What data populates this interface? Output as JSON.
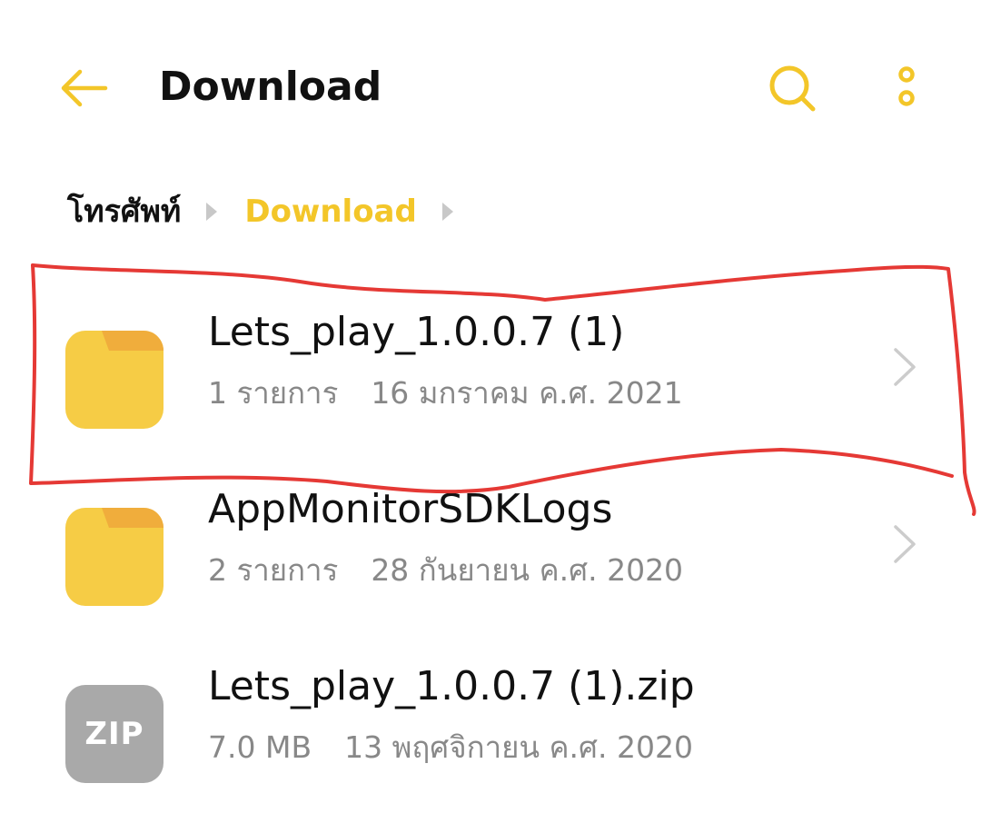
{
  "header": {
    "title": "Download",
    "back_icon": "arrow-left-icon",
    "search_icon": "search-icon",
    "more_icon": "more-vertical-icon"
  },
  "breadcrumb": {
    "root": "โทรศัพท์",
    "current": "Download"
  },
  "items": [
    {
      "type": "folder",
      "name": "Lets_play_1.0.0.7 (1)",
      "count": "1 รายการ",
      "date": "16 มกราคม ค.ศ. 2021"
    },
    {
      "type": "folder",
      "name": "AppMonitorSDKLogs",
      "count": "2 รายการ",
      "date": "28 กันยายน ค.ศ. 2020"
    },
    {
      "type": "zip",
      "icon_label": "ZIP",
      "name": "Lets_play_1.0.0.7 (1).zip",
      "size": "7.0 MB",
      "date": "13 พฤศจิกายน ค.ศ. 2020"
    }
  ],
  "colors": {
    "accent": "#f3c629",
    "folder": "#f6cc45",
    "folder_tab": "#f0ad3c",
    "zip": "#a9a9a9",
    "annotation": "#e53935"
  }
}
